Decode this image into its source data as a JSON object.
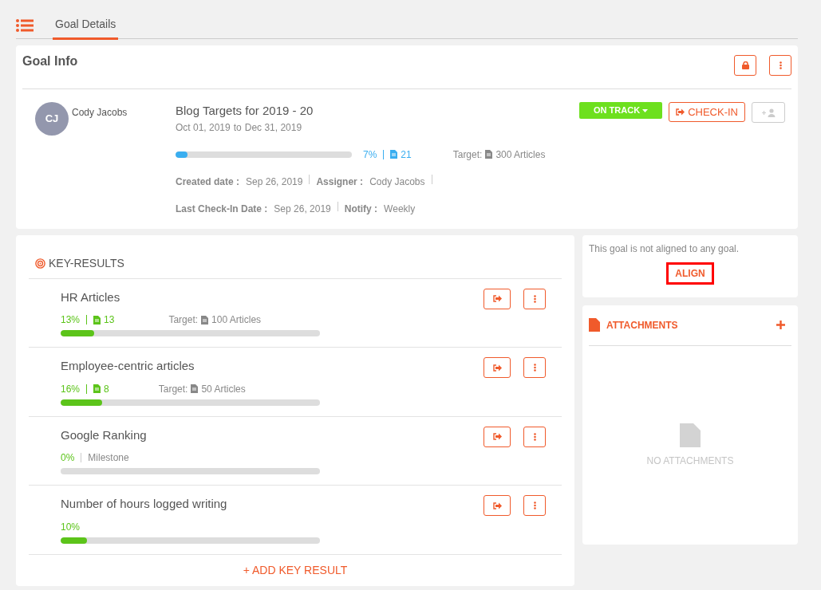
{
  "tabs": [
    {
      "label": "Goal Details",
      "selected": true
    }
  ],
  "goal_info": {
    "title": "Goal Info",
    "owner": {
      "initials": "CJ",
      "name": "Cody Jacobs"
    },
    "goal_title": "Blog Targets for 2019 - 20",
    "start": "Oct 01, 2019",
    "to": "to",
    "end": "Dec 31, 2019",
    "level": 0.07,
    "percent": "7%",
    "count": "21",
    "target_label": "Target:",
    "target": "300 Articles",
    "status": "ON TRACK",
    "checkin": "CHECK-IN",
    "meta": [
      [
        {
          "label": "Created date :",
          "value": "Sep 26, 2019"
        },
        {
          "label": "Assigner :",
          "value": "Cody Jacobs"
        }
      ],
      [
        {
          "label": "Last Check-In Date :",
          "value": "Sep 26, 2019"
        },
        {
          "label": "Notify :",
          "value": "Weekly"
        }
      ]
    ]
  },
  "key_results": {
    "title": "KEY-RESULTS",
    "items": [
      {
        "kind": "count",
        "name": "HR Articles",
        "percent": "13%",
        "count": "13",
        "target_label": "Target:",
        "target": "100 Articles",
        "level": 0.13
      },
      {
        "kind": "count",
        "name": "Employee-centric articles",
        "percent": "16%",
        "count": "8",
        "target_label": "Target:",
        "target": "50 Articles",
        "level": 0.16
      },
      {
        "kind": "milestone",
        "name": "Google Ranking",
        "percent": "0%",
        "type_label": "Milestone",
        "level": 0
      },
      {
        "kind": "percent",
        "name": "Number of hours logged writing",
        "percent": "10%",
        "level": 0.1
      }
    ],
    "add": "+ ADD KEY RESULT"
  },
  "alignment": {
    "text": "This goal is not aligned to any goal.",
    "button": "ALIGN"
  },
  "attachments": {
    "title": "ATTACHMENTS",
    "empty": "NO ATTACHMENTS"
  }
}
